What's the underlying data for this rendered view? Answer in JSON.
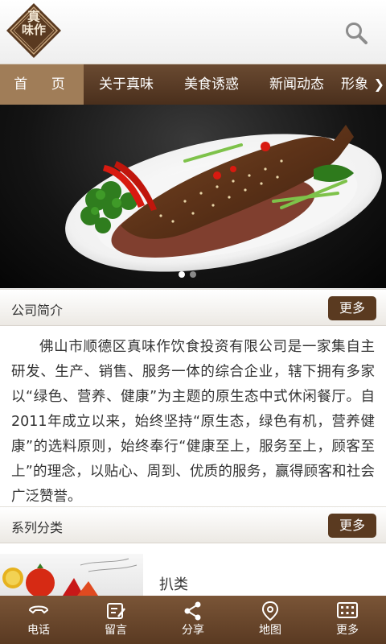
{
  "header": {
    "logo_text": "真味作",
    "search_icon": "search-icon"
  },
  "nav": {
    "items": [
      {
        "label": "首 页",
        "active": true
      },
      {
        "label": "关于真味"
      },
      {
        "label": "美食诱惑"
      },
      {
        "label": "新闻动态"
      },
      {
        "label": "形象"
      }
    ],
    "scroll_icon": "chevron-right-icon"
  },
  "banner": {
    "dots_count": 2,
    "active_dot": 1
  },
  "about": {
    "title": "公司简介",
    "more_label": "更多",
    "text": "佛山市顺德区真味作饮食投资有限公司是一家集自主研发、生产、销售、服务一体的综合企业，辖下拥有多家以“绿色、营养、健康”为主题的原生态中式休闲餐厅。自2011年成立以来，始终坚持“原生态，绿色有机，营养健康”的选料原则，始终奉行“健康至上，服务至上，顾客至上”的理念，以贴心、周到、优质的服务，赢得顾客和社会广泛赞誉。"
  },
  "categories": {
    "title": "系列分类",
    "more_label": "更多",
    "items": [
      {
        "name": "扒类"
      }
    ]
  },
  "bottom_bar": {
    "tabs": [
      {
        "label": "电话",
        "icon": "phone-icon"
      },
      {
        "label": "留言",
        "icon": "message-icon"
      },
      {
        "label": "分享",
        "icon": "share-icon"
      },
      {
        "label": "地图",
        "icon": "map-pin-icon"
      },
      {
        "label": "更多",
        "icon": "grid-icon"
      }
    ]
  },
  "colors": {
    "brand_brown": "#5a3a20",
    "nav_active": "#a07d58"
  }
}
